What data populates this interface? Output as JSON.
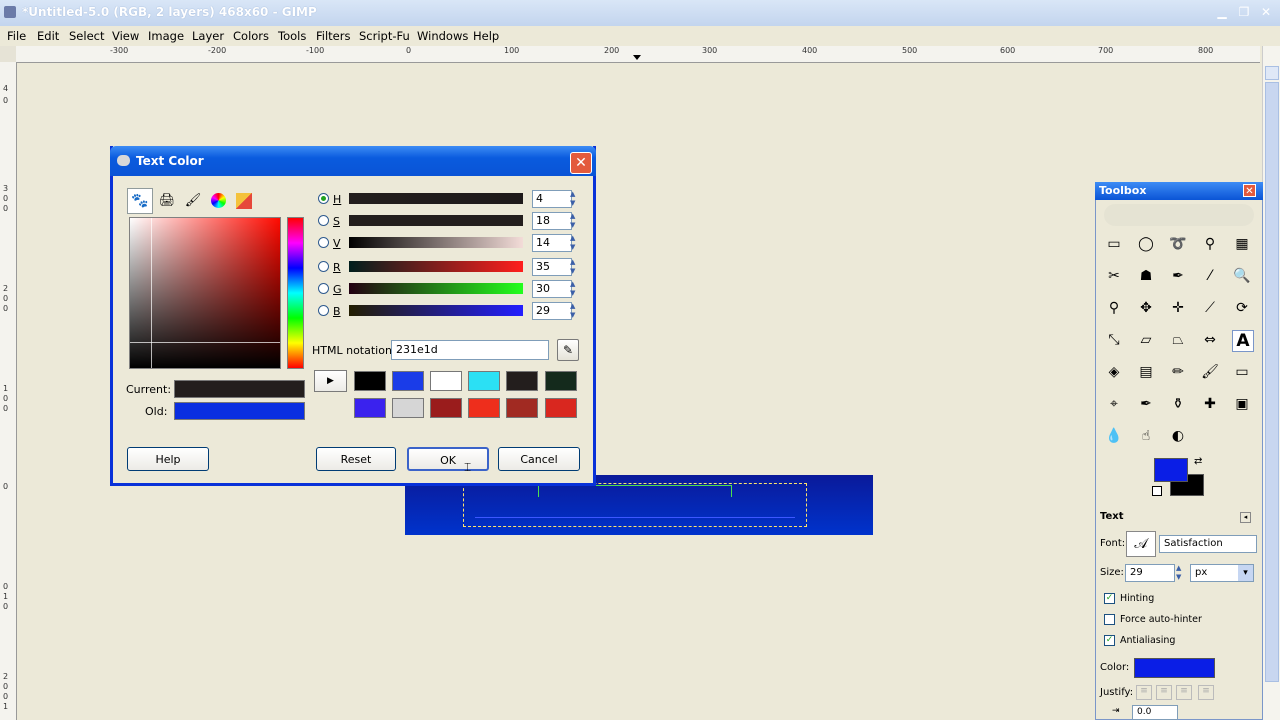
{
  "window": {
    "title": "*Untitled-5.0 (RGB, 2 layers) 468x60 - GIMP",
    "min": "▁",
    "max": "❐",
    "close": "✕"
  },
  "menubar": [
    "File",
    "Edit",
    "Select",
    "View",
    "Image",
    "Layer",
    "Colors",
    "Tools",
    "Filters",
    "Script-Fu",
    "Windows",
    "Help"
  ],
  "ruler": {
    "h": [
      "-300",
      "-200",
      "-100",
      "0",
      "100",
      "200",
      "300",
      "400",
      "500",
      "600",
      "700",
      "800"
    ],
    "v": [
      "4",
      "0",
      "3",
      "0",
      "0",
      "2",
      "0",
      "0",
      "1",
      "0",
      "0",
      "0",
      "0",
      "1",
      "0",
      "2",
      "0",
      "0",
      "1"
    ]
  },
  "dialog": {
    "title": "Text Color",
    "close": "✕",
    "channels": [
      {
        "label": "H",
        "value": "4",
        "checked": true
      },
      {
        "label": "S",
        "value": "18",
        "checked": false
      },
      {
        "label": "V",
        "value": "14",
        "checked": false
      },
      {
        "label": "R",
        "value": "35",
        "checked": false
      },
      {
        "label": "G",
        "value": "30",
        "checked": false
      },
      {
        "label": "B",
        "value": "29",
        "checked": false
      }
    ],
    "html_label": "HTML notation:",
    "html_value": "231e1d",
    "current_label": "Current:",
    "old_label": "Old:",
    "current_color": "#231e1d",
    "old_color": "#0a2ee0",
    "history_colors": [
      "#000000",
      "#1a3ce8",
      "#ffffff",
      "#2be0f4",
      "#231e1d",
      "#142a1c",
      "#3a22ee",
      "#d6d6d6",
      "#9a1c1c",
      "#ee2e1c",
      "#a12a22",
      "#d9271f"
    ],
    "buttons": {
      "help": "Help",
      "reset": "Reset",
      "ok": "OK",
      "cancel": "Cancel"
    }
  },
  "toolbox": {
    "title": "Toolbox",
    "close": "✕",
    "fg_color": "#0a1ee6",
    "bg_color": "#000000",
    "options_title": "Text",
    "font_label": "Font:",
    "font_value": "Satisfaction",
    "size_label": "Size:",
    "size_value": "29",
    "unit_value": "px",
    "hinting": "Hinting",
    "force_autohinter": "Force auto-hinter",
    "antialiasing": "Antialiasing",
    "color_label": "Color:",
    "justify_label": "Justify:",
    "indent_value": "0.0"
  }
}
